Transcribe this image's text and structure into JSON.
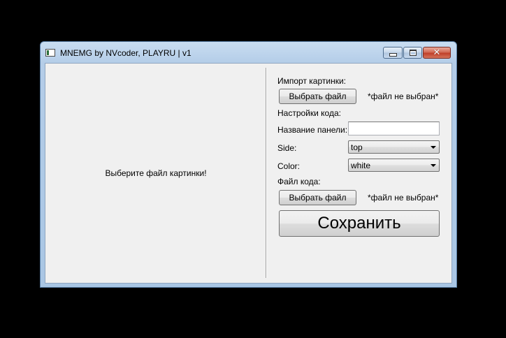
{
  "window": {
    "title": "MNEMG by NVcoder, PLAYRU | v1",
    "icon": "app-window-icon",
    "caption_buttons": {
      "minimize_icon": "minimize-icon",
      "maximize_icon": "maximize-icon",
      "close_icon": "close-icon",
      "close_glyph": "✕"
    }
  },
  "preview": {
    "placeholder": "Выберите файл картинки!"
  },
  "form": {
    "import_label": "Импорт картинки:",
    "import_button": "Выбрать файл",
    "import_status": "*файл не выбран*",
    "settings_label": "Настройки кода:",
    "panel_name_label": "Название панели:",
    "panel_name_value": "",
    "side_label": "Side:",
    "side_value": "top",
    "color_label": "Color:",
    "color_value": "white",
    "code_file_label": "Файл кода:",
    "code_file_button": "Выбрать файл",
    "code_file_status": "*файл не выбран*",
    "save_button": "Сохранить"
  },
  "colors": {
    "frame": "#b4cde8",
    "client_bg": "#f0f0f0",
    "close_button": "#c0402a",
    "desktop": "#000000"
  }
}
